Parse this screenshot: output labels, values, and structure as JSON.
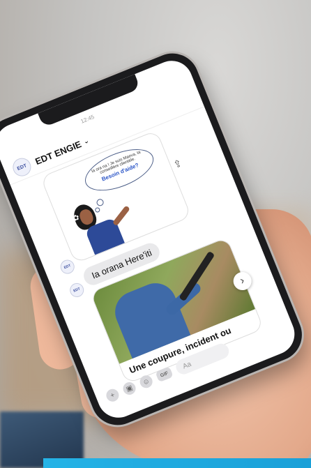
{
  "header": {
    "title": "EDT ENGIE",
    "logo_text": "EDT",
    "chevron": "⌄",
    "time": "12:45"
  },
  "intro_card": {
    "thought_text": "Ia ora na ! Je suis Maeva, ta conseillère clientèle.",
    "thought_cta": "Besoin d'aide?"
  },
  "messages": [
    {
      "text": "Ia orana Here'iti"
    }
  ],
  "photo_card": {
    "caption": "Une coupure, incident ou"
  },
  "composer": {
    "placeholder": "Aa",
    "gif_label": "GIF"
  },
  "icons": [
    "share-icon",
    "plus-icon",
    "image-icon",
    "sticker-icon",
    "chevron-right-icon"
  ],
  "colors": {
    "accent": "#2c56c7",
    "bar": "#25b3e6"
  }
}
